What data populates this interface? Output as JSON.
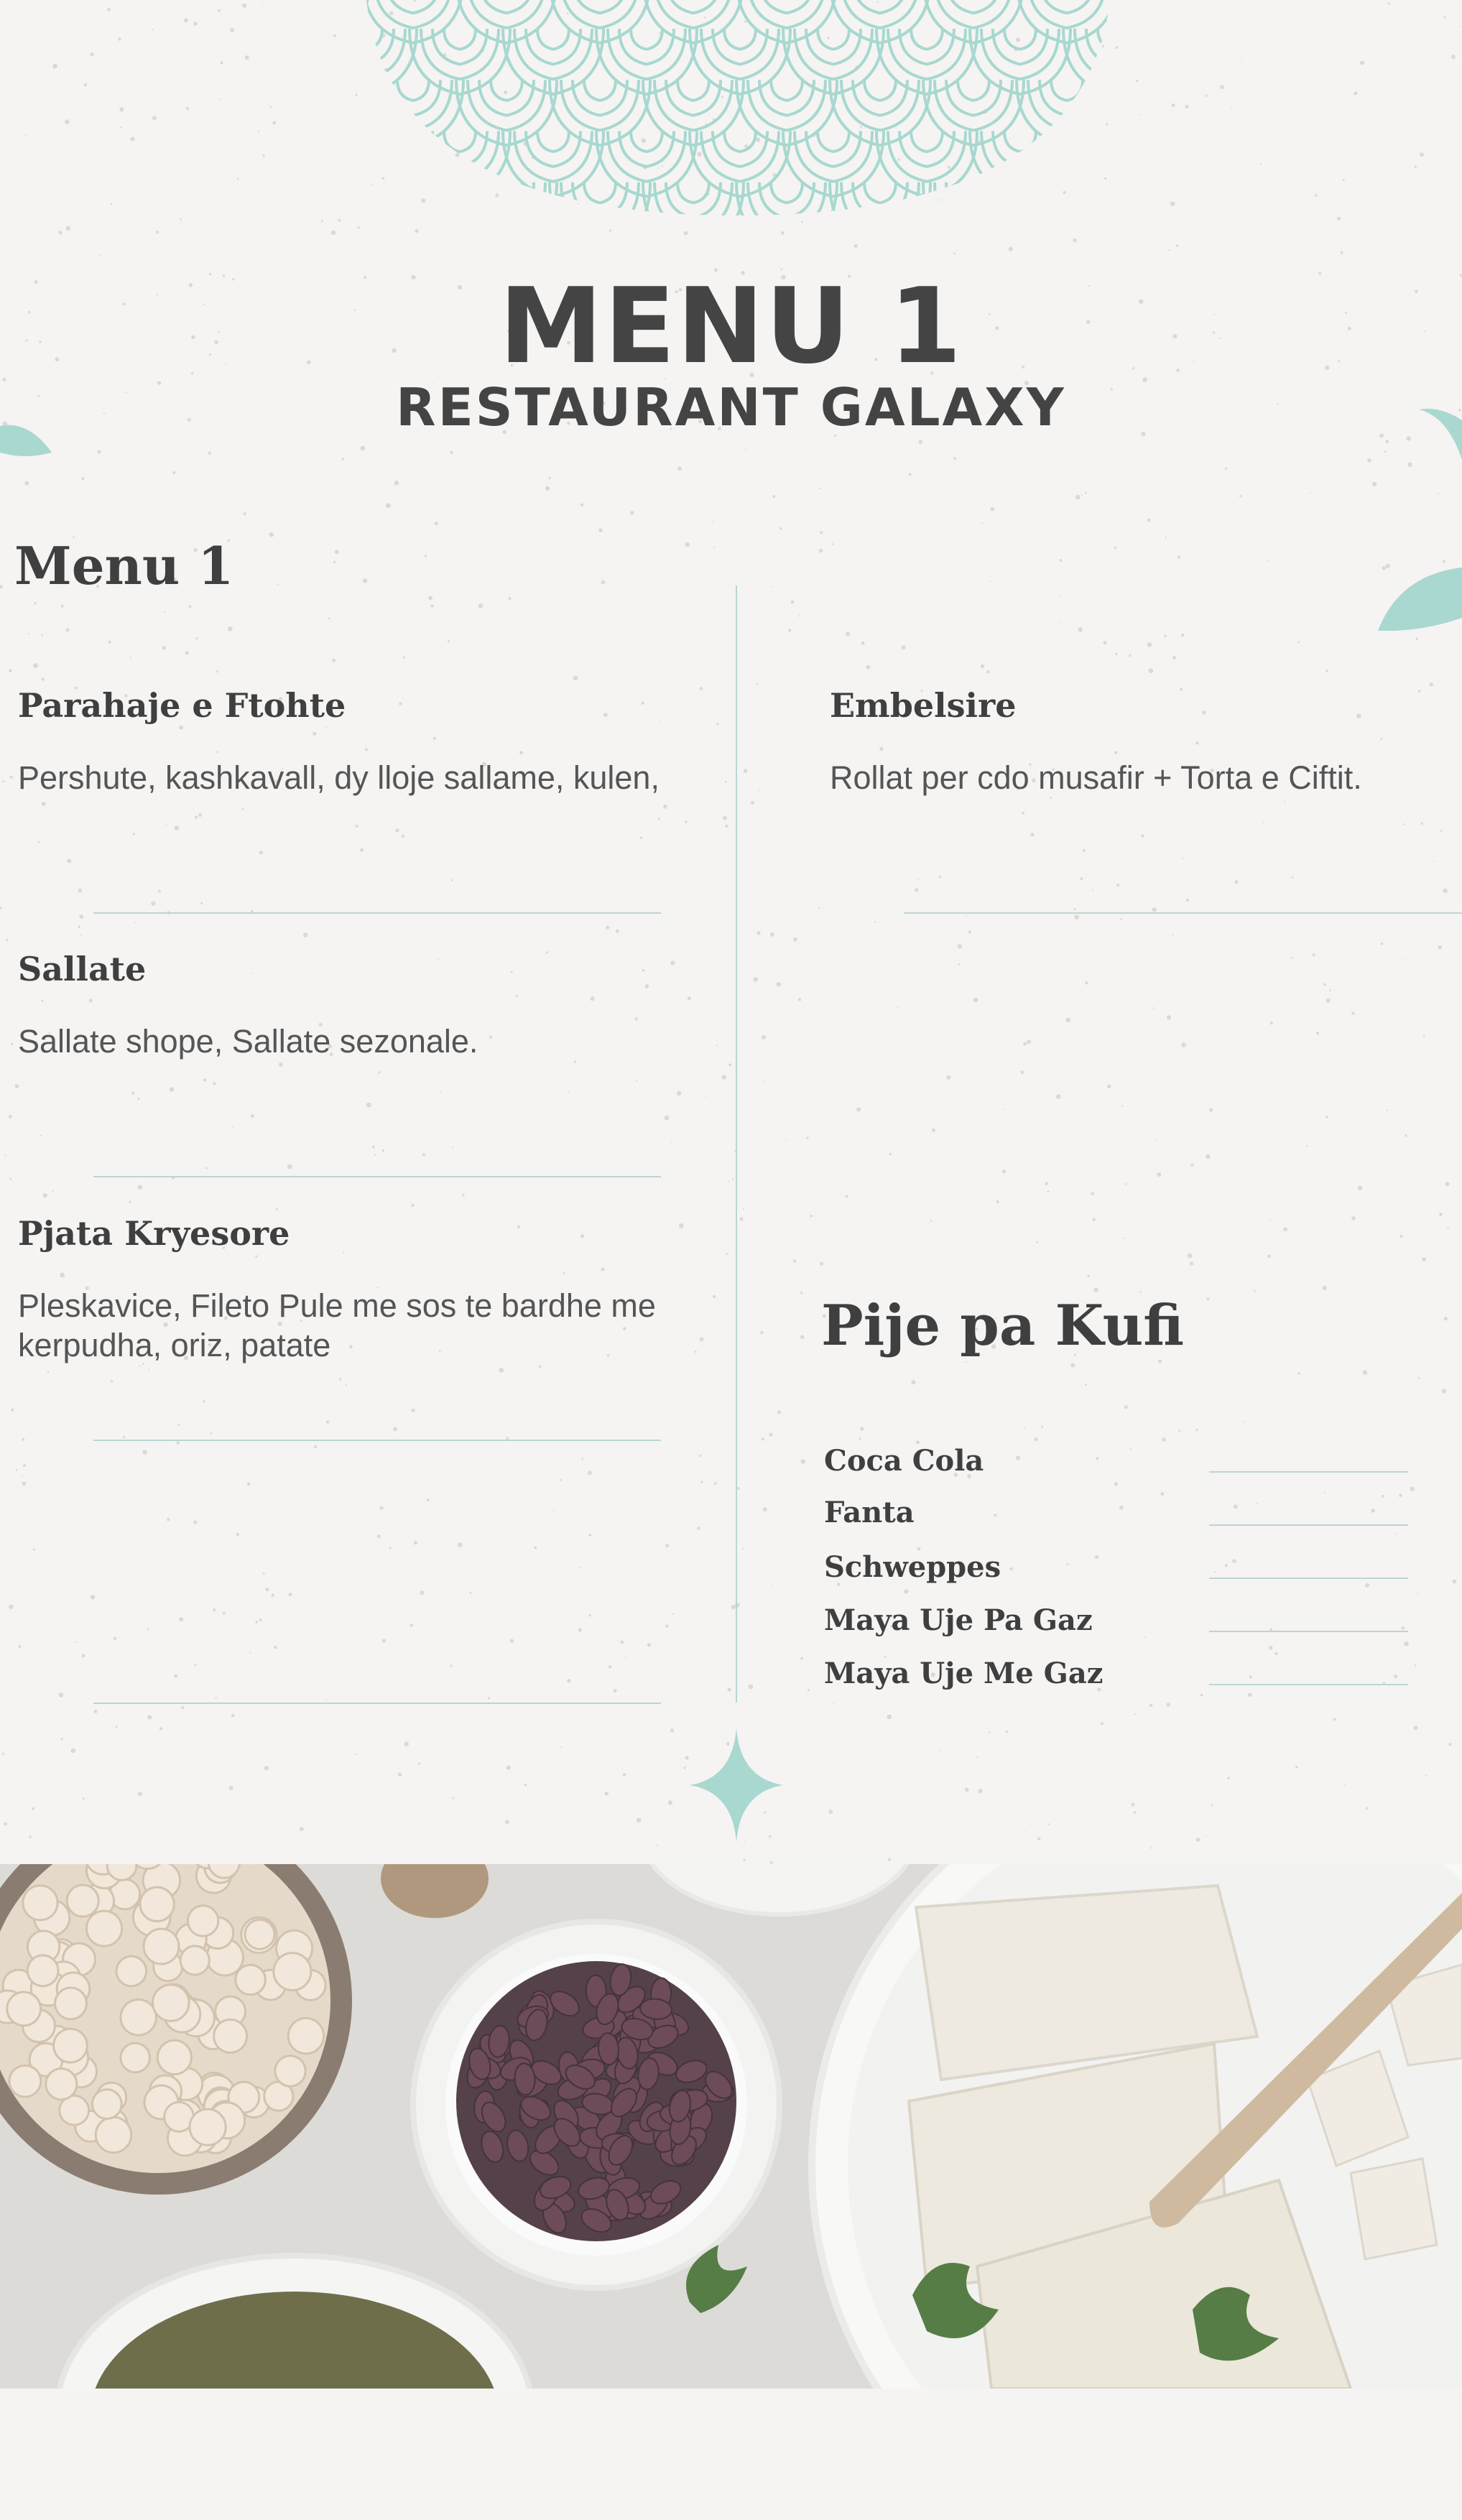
{
  "header": {
    "title": "MENU 1",
    "subtitle": "RESTAURANT GALAXY"
  },
  "menu": {
    "heading": "Menu 1",
    "left_items": [
      {
        "name": "Parahaje e Ftohte",
        "description": "Pershute, kashkavall, dy lloje sallame, kulen,"
      },
      {
        "name": "Sallate",
        "description": "Sallate shope, Sallate sezonale."
      },
      {
        "name": "Pjata Kryesore",
        "description": "Pleskavice, Fileto Pule me sos te bardhe me kerpudha, oriz, patate"
      }
    ],
    "right_items": [
      {
        "name": "Embelsire",
        "description": "Rollat per cdo musafir + Torta e Ciftit."
      }
    ]
  },
  "drinks": {
    "heading": "Pije pa Kufi",
    "items": [
      "Coca Cola",
      "Fanta",
      "Schweppes",
      "Maya Uje Pa Gaz",
      "Maya Uje Me Gaz"
    ]
  },
  "colors": {
    "accent": "#a8d8d0",
    "background": "#f5f4f3",
    "text": "#444444"
  },
  "icons": [
    "scallop-pattern-ornament",
    "leaf-icon",
    "sparkle-star-icon"
  ]
}
